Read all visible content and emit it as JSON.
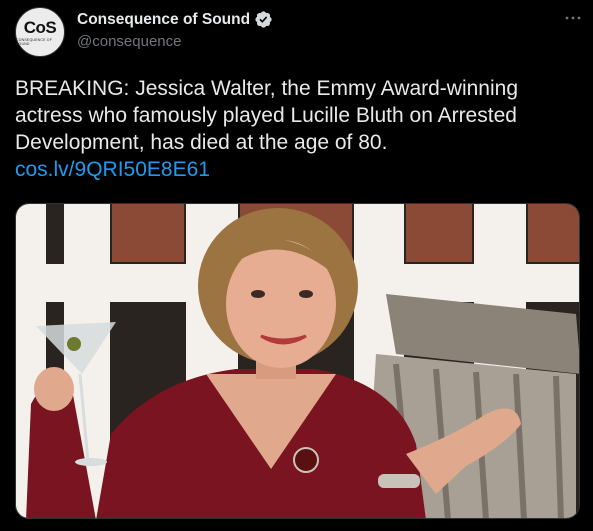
{
  "account": {
    "display_name": "Consequence of Sound",
    "handle": "@consequence",
    "avatar_text": "CoS",
    "avatar_subtext": "CONSEQUENCE OF SOUND",
    "verified": true
  },
  "tweet": {
    "text": "BREAKING: Jessica Walter, the Emmy Award-winning actress who famously played Lucille Bluth on Arrested Development, has died at the age of 80.",
    "link": "cos.lv/9QRI50E8E61"
  },
  "icons": {
    "verified": "verified-badge-icon",
    "more": "more-options-icon"
  },
  "colors": {
    "background": "#000000",
    "text": "#e7e9ea",
    "secondary_text": "#71767b",
    "link": "#1d9bf0"
  }
}
